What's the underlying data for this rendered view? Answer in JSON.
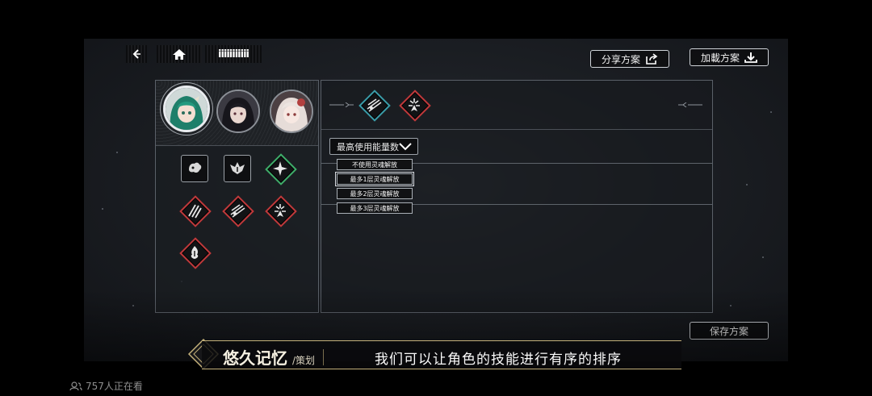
{
  "nav": {
    "back_icon": "chevron-left-icon",
    "home_icon": "home-icon",
    "team_name": "iiiiiiiiiii"
  },
  "buttons": {
    "share": "分享方案",
    "load": "加載方案",
    "save": "保存方案"
  },
  "characters": [
    {
      "name": "green-hair-character",
      "selected": true
    },
    {
      "name": "dark-hair-character",
      "selected": false
    },
    {
      "name": "white-hair-character",
      "selected": false
    }
  ],
  "skills": [
    {
      "icon": "beast-skill-icon",
      "style": "square",
      "color": "#9aa0a6"
    },
    {
      "icon": "bat-wing-skill-icon",
      "style": "square",
      "color": "#9aa0a6"
    },
    {
      "icon": "shatter-skill-icon",
      "style": "diamond",
      "color": "#3fae6a"
    },
    {
      "icon": "claw-slash-skill-icon",
      "style": "diamond",
      "color": "#c0393b"
    },
    {
      "icon": "multi-slash-skill-icon",
      "style": "diamond",
      "color": "#c0393b"
    },
    {
      "icon": "burst-skill-icon",
      "style": "diamond",
      "color": "#c0393b"
    },
    {
      "icon": "spirit-flame-skill-icon",
      "style": "diamond",
      "color": "#c0393b"
    }
  ],
  "team_skills": [
    {
      "icon": "multi-slash-skill-icon",
      "color": "#3a9ca8"
    },
    {
      "icon": "burst-skill-icon",
      "color": "#c0393b"
    }
  ],
  "energy_dropdown": {
    "label": "最高使用能量数",
    "options": [
      "不使用灵魂解放",
      "最多1层灵魂解放",
      "最多2层灵魂解放",
      "最多3层灵魂解放"
    ],
    "selected_index": 1
  },
  "subtitle": {
    "name": "悠久记忆",
    "role": "/策划",
    "text": "我们可以让角色的技能进行有序的排序"
  },
  "viewers": {
    "text": "757人正在看"
  },
  "colors": {
    "accent_gold": "#c3b07a",
    "diamond_red": "#c0393b",
    "diamond_green": "#3fae6a",
    "diamond_teal": "#3a9ca8"
  }
}
